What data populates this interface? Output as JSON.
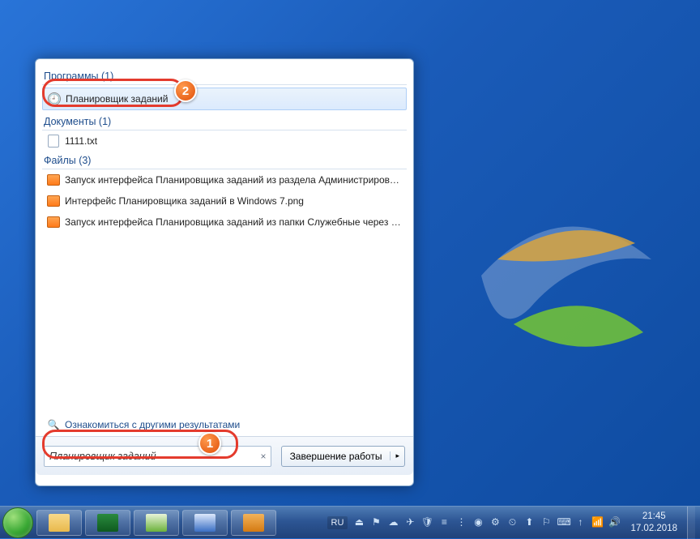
{
  "startMenu": {
    "groups": [
      {
        "header": "Программы (1)",
        "items": [
          {
            "name": "task-scheduler-item",
            "label": "Планировщик заданий",
            "icon": "time",
            "highlight": true
          }
        ]
      },
      {
        "header": "Документы (1)",
        "items": [
          {
            "name": "doc-1111",
            "label": "1111.txt",
            "icon": "txt"
          }
        ]
      },
      {
        "header": "Файлы (3)",
        "items": [
          {
            "name": "file-1",
            "label": "Запуск интерфейса Планировщика заданий из раздела Администрирование...",
            "icon": "png"
          },
          {
            "name": "file-2",
            "label": "Интерфейс Планировщика заданий в Windows 7.png",
            "icon": "png"
          },
          {
            "name": "file-3",
            "label": "Запуск интерфейса Планировщика заданий из папки Служебные через мен...",
            "icon": "png"
          }
        ]
      }
    ],
    "moreLink": "Ознакомиться с другими результатами",
    "search": {
      "value": "Планировщик заданий",
      "clear": "×"
    },
    "shutdown": {
      "label": "Завершение работы",
      "arrow": "▸"
    }
  },
  "badges": {
    "b1": "1",
    "b2": "2"
  },
  "taskbar": {
    "apps": [
      {
        "name": "explorer",
        "color": "linear-gradient(#f7d98a,#e9b94c)"
      },
      {
        "name": "taskmgr",
        "color": "linear-gradient(#2a8a3e,#0e5a1f)"
      },
      {
        "name": "excel",
        "color": "linear-gradient(#e8f3d8,#6bb13a)"
      },
      {
        "name": "word",
        "color": "linear-gradient(#dce8fb,#3a6fc4)"
      },
      {
        "name": "media",
        "color": "linear-gradient(#f2b25a,#d47a12)"
      }
    ],
    "lang": "RU",
    "tray": [
      "⏏",
      "⚑",
      "☁",
      "✈",
      "🛡",
      "≡",
      "⋮",
      "◉",
      "⚙",
      "⏲",
      "⬆",
      "⚐",
      "⌨",
      "↑",
      "📶",
      "🔊"
    ],
    "clock": {
      "time": "21:45",
      "date": "17.02.2018"
    }
  }
}
